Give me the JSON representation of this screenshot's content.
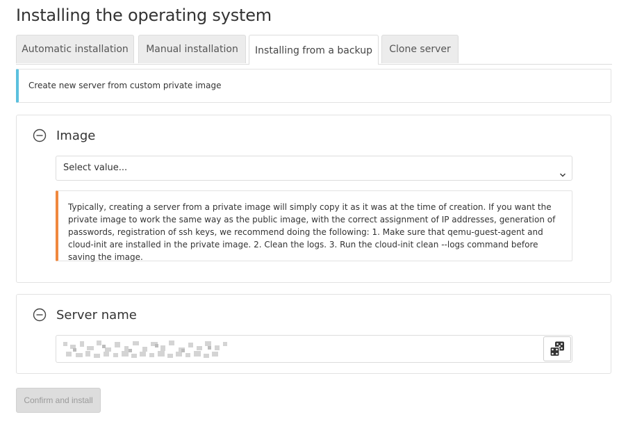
{
  "page": {
    "title": "Installing the operating system"
  },
  "tabs": [
    {
      "label": "Automatic installation",
      "active": false
    },
    {
      "label": "Manual installation",
      "active": false
    },
    {
      "label": "Installing from a backup",
      "active": true
    },
    {
      "label": "Clone server",
      "active": false
    }
  ],
  "info": {
    "text": "Create new server from custom private image"
  },
  "image_section": {
    "title": "Image",
    "select_value": "Select value...",
    "warning": "Typically, creating a server from a private image will simply copy it as it was at the time of creation. If you want the private image to work the same way as the public image, with the correct assignment of IP addresses, generation of passwords, registration of ssh keys, we recommend doing the following: 1. Make sure that qemu-guest-agent and cloud-init are installed in the private image. 2. Clean the logs. 3. Run the cloud-init clean --logs command before saving the image."
  },
  "server_name_section": {
    "title": "Server name",
    "input_value_obscured": true
  },
  "actions": {
    "confirm_label": "Confirm and install",
    "confirm_disabled": true
  },
  "colors": {
    "info_accent": "#5bc0de",
    "warning_accent": "#f0883e",
    "tab_inactive_bg": "#ececec",
    "disabled_button_bg": "#dddddd"
  },
  "icons": {
    "collapse": "minus-circle-icon",
    "dropdown": "chevron-down-icon",
    "random_name": "dice-icon"
  }
}
